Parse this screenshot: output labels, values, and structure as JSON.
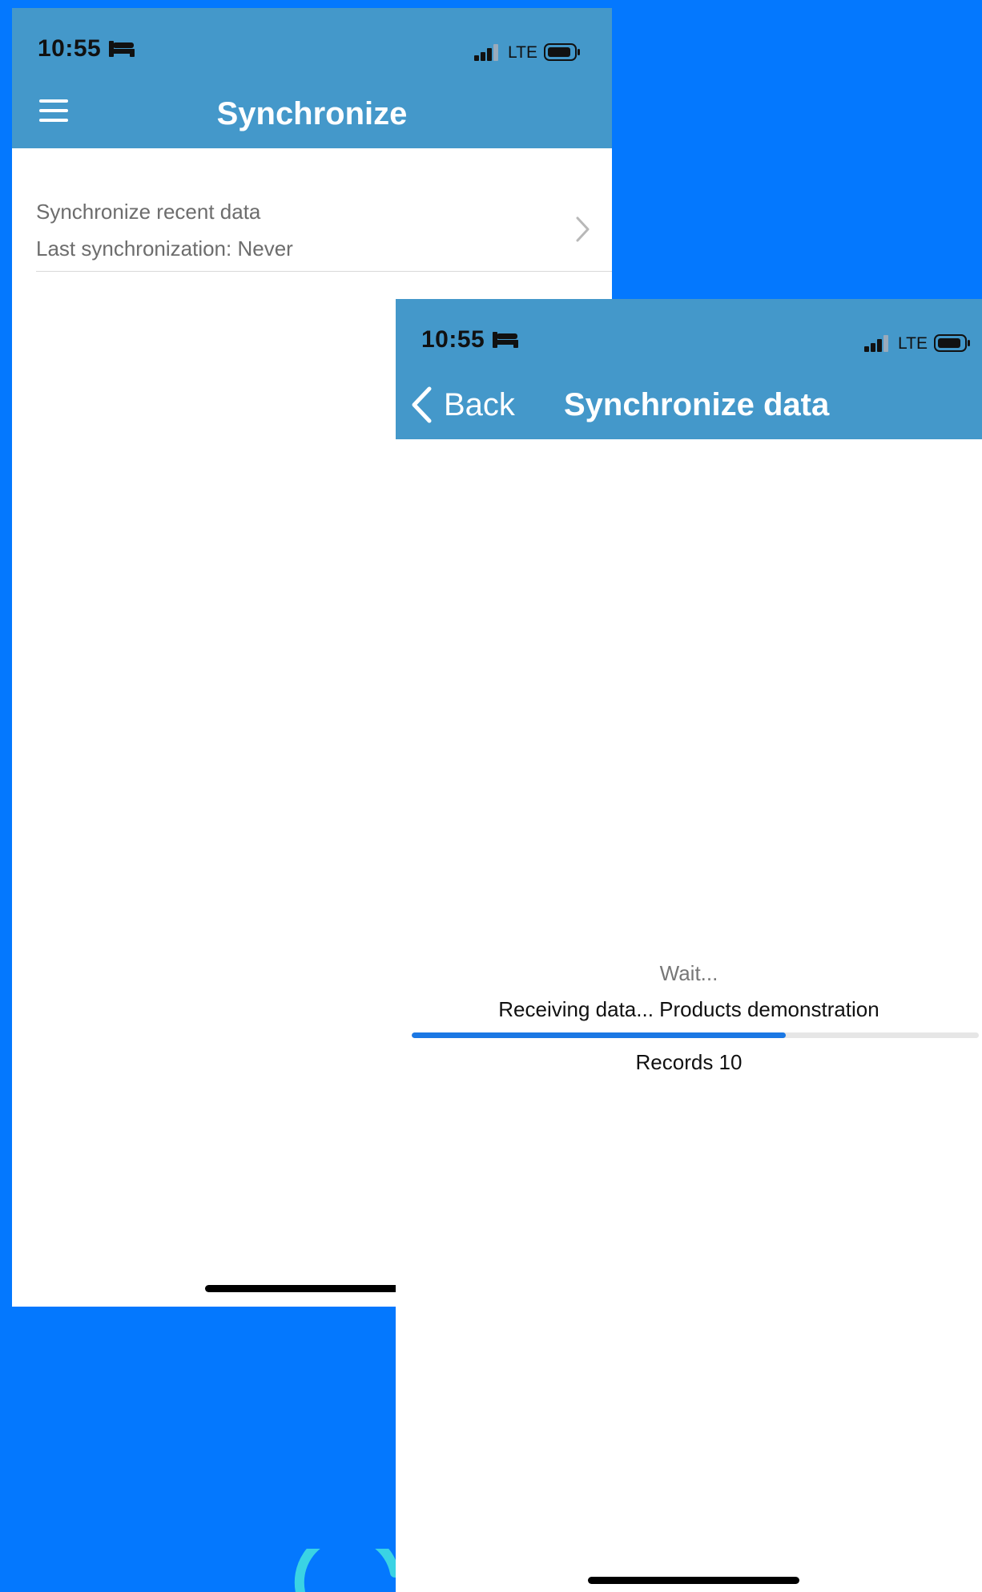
{
  "colors": {
    "background": "#0478fe",
    "appbar": "#4498ca",
    "progress": "#1b78e4",
    "spinner": "#3ad3e4"
  },
  "screen1": {
    "status": {
      "time": "10:55",
      "network": "LTE",
      "icons": [
        "sleep-bed-icon",
        "signal-bars-icon",
        "battery-icon"
      ]
    },
    "header": {
      "title": "Synchronize",
      "menu_icon": "hamburger-menu-icon"
    },
    "list": {
      "items": [
        {
          "title": "Synchronize recent data",
          "subtitle": "Last synchronization: Never",
          "icon": "chevron-right-icon"
        }
      ]
    }
  },
  "screen2": {
    "status": {
      "time": "10:55",
      "network": "LTE",
      "icons": [
        "sleep-bed-icon",
        "signal-bars-icon",
        "battery-icon"
      ]
    },
    "header": {
      "back_label": "Back",
      "back_icon": "chevron-left-icon",
      "title": "Synchronize data"
    },
    "progress": {
      "wait_text": "Wait...",
      "status_text": "Receiving data... Products demonstration",
      "fraction": 0.66,
      "records_text": "Records 10"
    }
  },
  "spinner": {
    "icon": "loading-spinner-icon"
  }
}
